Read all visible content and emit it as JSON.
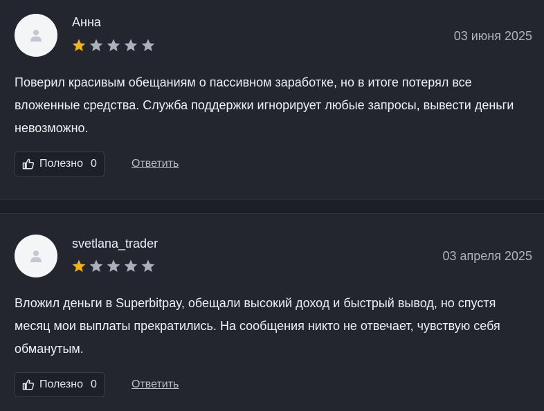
{
  "reviews": [
    {
      "author": "Анна",
      "date": "03 июня 2025",
      "rating": 1,
      "max_rating": 5,
      "text": "Поверил красивым обещаниям о пассивном заработке, но в итоге потерял все вложенные средства. Служба поддержки игнорирует любые запросы, вывести деньги невозможно.",
      "helpful_label": "Полезно",
      "helpful_count": "0",
      "reply_label": "Ответить"
    },
    {
      "author": "svetlana_trader",
      "date": "03 апреля 2025",
      "rating": 1,
      "max_rating": 5,
      "text": "Вложил деньги в Superbitpay, обещали высокий доход и быстрый вывод, но спустя месяц мои выплаты прекратились. На сообщения никто не отвечает, чувствую себя обманутым.",
      "helpful_label": "Полезно",
      "helpful_count": "0",
      "reply_label": "Ответить"
    }
  ],
  "colors": {
    "star_filled": "#f2b31b",
    "star_empty": "#aab0bd",
    "background": "#23262e"
  },
  "icons": {
    "avatar": "user-silhouette-icon",
    "star": "star-icon",
    "helpful": "thumbs-up-icon"
  }
}
